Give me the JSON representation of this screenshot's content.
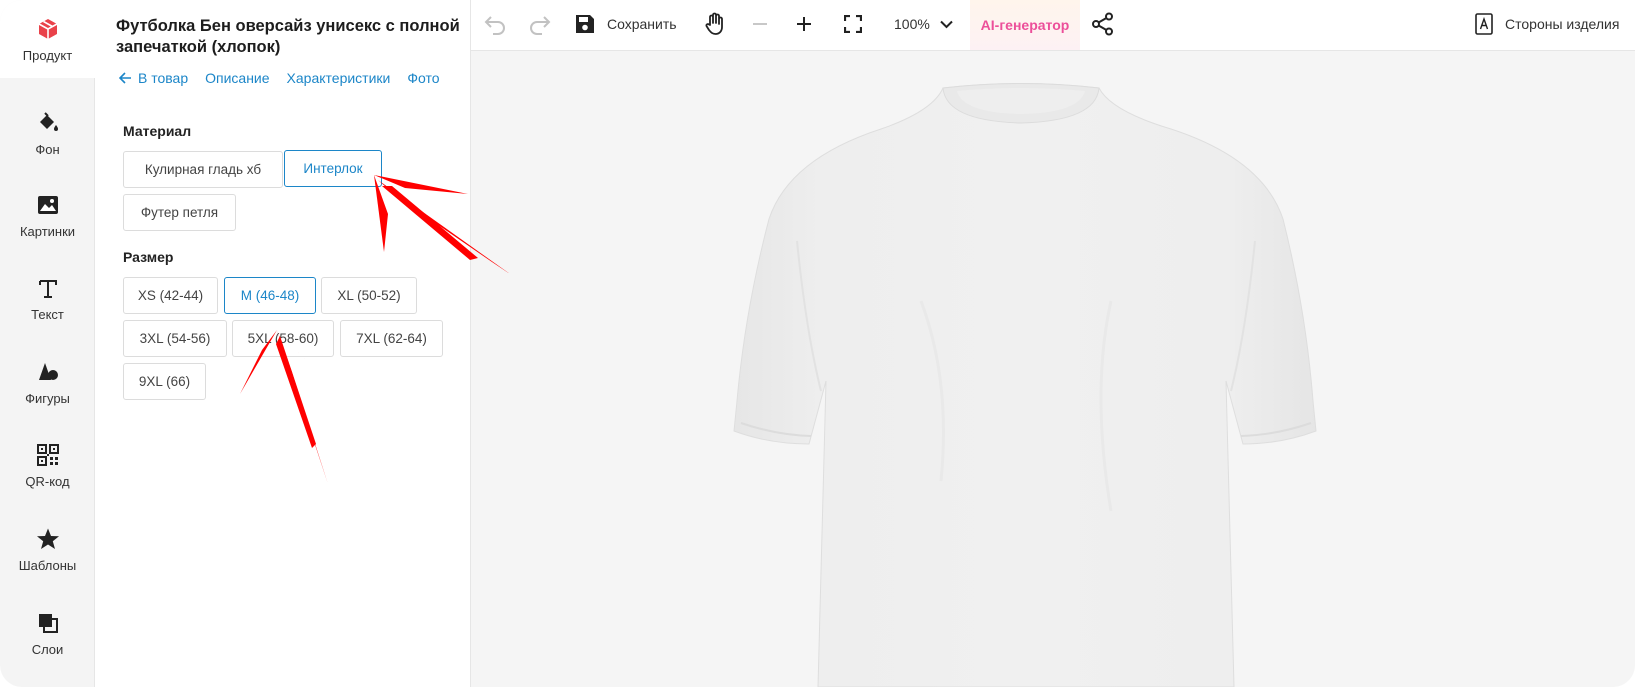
{
  "rail": {
    "items": [
      {
        "label": "Продукт",
        "icon": "product-icon"
      },
      {
        "label": "Фон",
        "icon": "paint-bucket-icon"
      },
      {
        "label": "Картинки",
        "icon": "image-icon"
      },
      {
        "label": "Текст",
        "icon": "text-icon"
      },
      {
        "label": "Фигуры",
        "icon": "shapes-icon"
      },
      {
        "label": "QR-код",
        "icon": "qr-code-icon"
      },
      {
        "label": "Шаблоны",
        "icon": "star-icon"
      },
      {
        "label": "Слои",
        "icon": "layers-icon"
      }
    ]
  },
  "panel": {
    "title": "Футболка Бен оверсайз унисекс с полной запечаткой (хлопок)",
    "tabs": {
      "back": "В товар",
      "description": "Описание",
      "specs": "Характеристики",
      "photo": "Фото"
    },
    "material": {
      "label": "Материал",
      "options": [
        "Кулирная гладь хб",
        "Интерлок",
        "Футер петля"
      ],
      "selected": "Интерлок"
    },
    "size": {
      "label": "Размер",
      "options": [
        "XS (42-44)",
        "M (46-48)",
        "XL (50-52)",
        "3XL (54-56)",
        "5XL (58-60)",
        "7XL (62-64)",
        "9XL (66)"
      ],
      "selected": "M (46-48)"
    }
  },
  "toolbar": {
    "save": "Сохранить",
    "zoom": "100%",
    "ai": "AI-генератор",
    "sides": "Стороны изделия"
  },
  "colors": {
    "accent": "#1c86c8",
    "ai_text": "#ec4f9a",
    "product_icon": "#e9424a",
    "annotation_arrow": "#ff0000"
  }
}
